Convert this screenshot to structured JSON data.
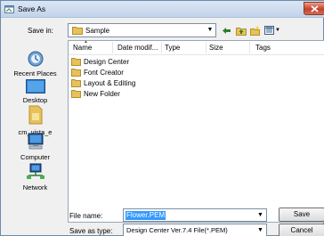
{
  "window": {
    "title": "Save As",
    "close_symbol": "x"
  },
  "toolbar": {
    "save_in_label": "Save in:",
    "save_in_value": "Sample"
  },
  "places": [
    {
      "label": "Recent Places",
      "icon": "recent-places-icon"
    },
    {
      "label": "Desktop",
      "icon": "desktop-icon"
    },
    {
      "label": "cm_vista_e",
      "icon": "user-folder-icon"
    },
    {
      "label": "Computer",
      "icon": "computer-icon"
    },
    {
      "label": "Network",
      "icon": "network-icon"
    }
  ],
  "file_list": {
    "columns": [
      "Name",
      "Date modif...",
      "Type",
      "Size",
      "Tags"
    ],
    "items": [
      "Design Center",
      "Font Creator",
      "Layout & Editing",
      "New Folder"
    ]
  },
  "footer": {
    "file_name_label": "File name:",
    "file_name_value": "Flower.PEM",
    "save_as_type_label": "Save as type:",
    "save_as_type_value": "Design Center Ver.7.4 File(*.PEM)",
    "save_button": "Save",
    "cancel_button": "Cancel"
  },
  "colors": {
    "selection": "#3399ff",
    "folder": "#e8c15a",
    "close": "#c4422b"
  }
}
